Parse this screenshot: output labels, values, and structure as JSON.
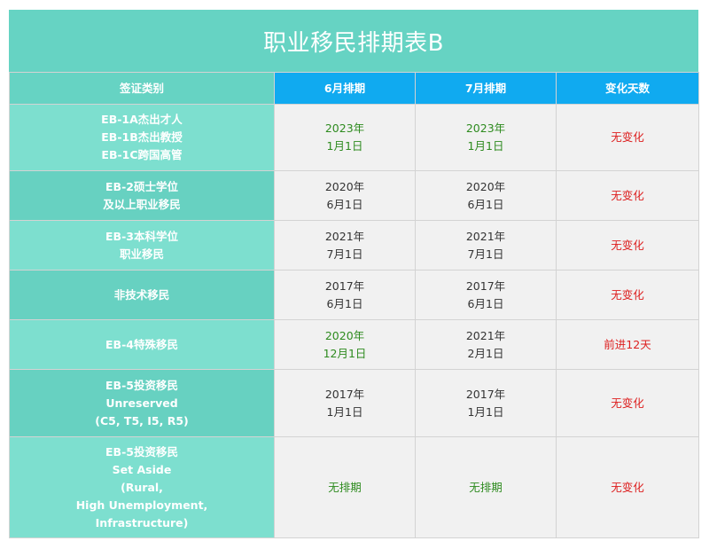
{
  "title": "职业移民排期表B",
  "headers": {
    "category": "签证类别",
    "june": "6月排期",
    "july": "7月排期",
    "change": "变化天数"
  },
  "colors": {
    "teal": "#66d3c3",
    "blue": "#10aaf0",
    "green": "#2e8b1f",
    "red": "#dd1f1f"
  },
  "rows": [
    {
      "category": [
        "EB-1A杰出才人",
        "EB-1B杰出教授",
        "EB-1C跨国高管"
      ],
      "june": [
        "2023年",
        "1月1日"
      ],
      "july": [
        "2023年",
        "1月1日"
      ],
      "change": "无变化"
    },
    {
      "category": [
        "EB-2硕士学位",
        "及以上职业移民"
      ],
      "june": [
        "2020年",
        "6月1日"
      ],
      "july": [
        "2020年",
        "6月1日"
      ],
      "change": "无变化"
    },
    {
      "category": [
        "EB-3本科学位",
        "职业移民"
      ],
      "june": [
        "2021年",
        "7月1日"
      ],
      "july": [
        "2021年",
        "7月1日"
      ],
      "change": "无变化"
    },
    {
      "category": [
        "非技术移民"
      ],
      "june": [
        "2017年",
        "6月1日"
      ],
      "july": [
        "2017年",
        "6月1日"
      ],
      "change": "无变化"
    },
    {
      "category": [
        "EB-4特殊移民"
      ],
      "june": [
        "2020年",
        "12月1日"
      ],
      "july": [
        "2021年",
        "2月1日"
      ],
      "change": "前进12天"
    },
    {
      "category": [
        "EB-5投资移民",
        "Unreserved",
        "(C5, T5, I5, R5)"
      ],
      "june": [
        "2017年",
        "1月1日"
      ],
      "july": [
        "2017年",
        "1月1日"
      ],
      "change": "无变化"
    },
    {
      "category": [
        "EB-5投资移民",
        "Set Aside",
        "(Rural,",
        "High Unemployment,",
        "Infrastructure)"
      ],
      "june": [
        "无排期"
      ],
      "july": [
        "无排期"
      ],
      "change": "无变化"
    }
  ]
}
